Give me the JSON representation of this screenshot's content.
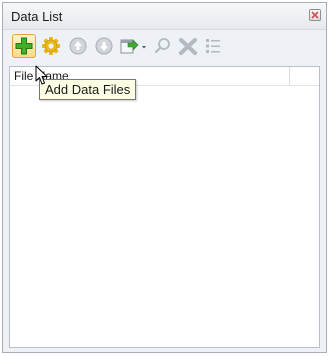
{
  "panel": {
    "title": "Data List",
    "close_icon": "close-icon"
  },
  "toolbar": {
    "buttons": [
      {
        "name": "add-data-files-button",
        "icon": "plus-icon",
        "active": true
      },
      {
        "name": "settings-button",
        "icon": "gear-icon"
      },
      {
        "name": "move-up-button",
        "icon": "arrow-up-circle-icon"
      },
      {
        "name": "move-down-button",
        "icon": "arrow-down-circle-icon"
      },
      {
        "name": "export-button",
        "icon": "export-icon",
        "has_dropdown": true
      },
      {
        "name": "search-button",
        "icon": "search-icon"
      },
      {
        "name": "remove-button",
        "icon": "remove-x-icon"
      },
      {
        "name": "list-options-button",
        "icon": "list-icon"
      }
    ]
  },
  "list": {
    "columns": [
      "File Name"
    ]
  },
  "tooltip": {
    "text": "Add Data Files"
  },
  "colors": {
    "add_green": "#3fae2a",
    "gear_yellow": "#e8b818",
    "disabled_gray": "#b5bac2",
    "tooltip_bg": "#ffffe6",
    "panel_bg": "#eef1f5"
  }
}
